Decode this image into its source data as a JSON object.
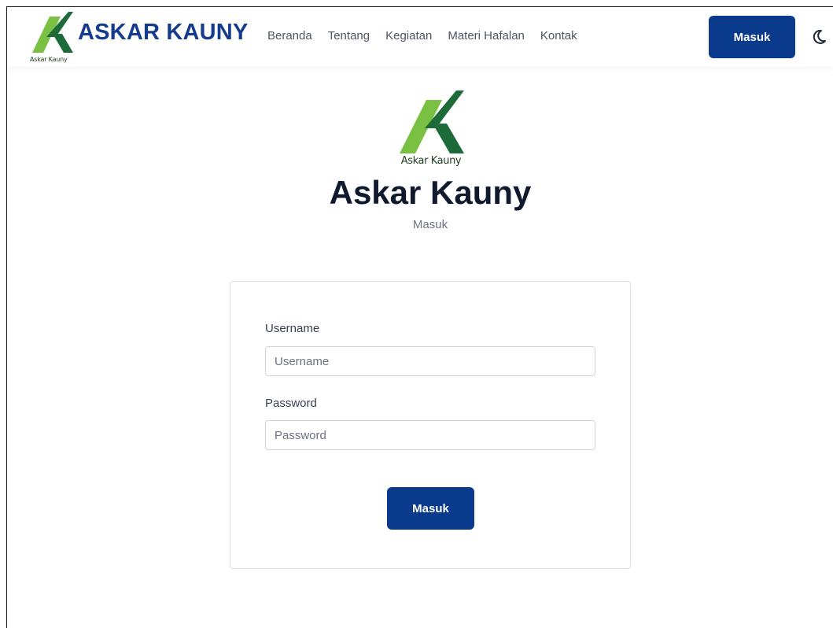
{
  "brand": {
    "name": "ASKAR KAUNY",
    "small_caption": "Askar Kauny"
  },
  "nav": {
    "links": [
      {
        "label": "Beranda"
      },
      {
        "label": "Tentang"
      },
      {
        "label": "Kegiatan"
      },
      {
        "label": "Materi Hafalan"
      },
      {
        "label": "Kontak"
      }
    ],
    "login_button": "Masuk",
    "theme_toggle_icon": "moon-icon"
  },
  "hero": {
    "logo_caption": "Askar Kauny",
    "title": "Askar Kauny",
    "subtitle": "Masuk"
  },
  "form": {
    "username_label": "Username",
    "username_placeholder": "Username",
    "username_value": "",
    "password_label": "Password",
    "password_placeholder": "Password",
    "password_value": "",
    "submit_label": "Masuk"
  },
  "colors": {
    "primary": "#0a3a8c",
    "brand_text": "#163b8c",
    "logo_light_green": "#7ac143",
    "logo_dark_green": "#1e6b3a"
  }
}
